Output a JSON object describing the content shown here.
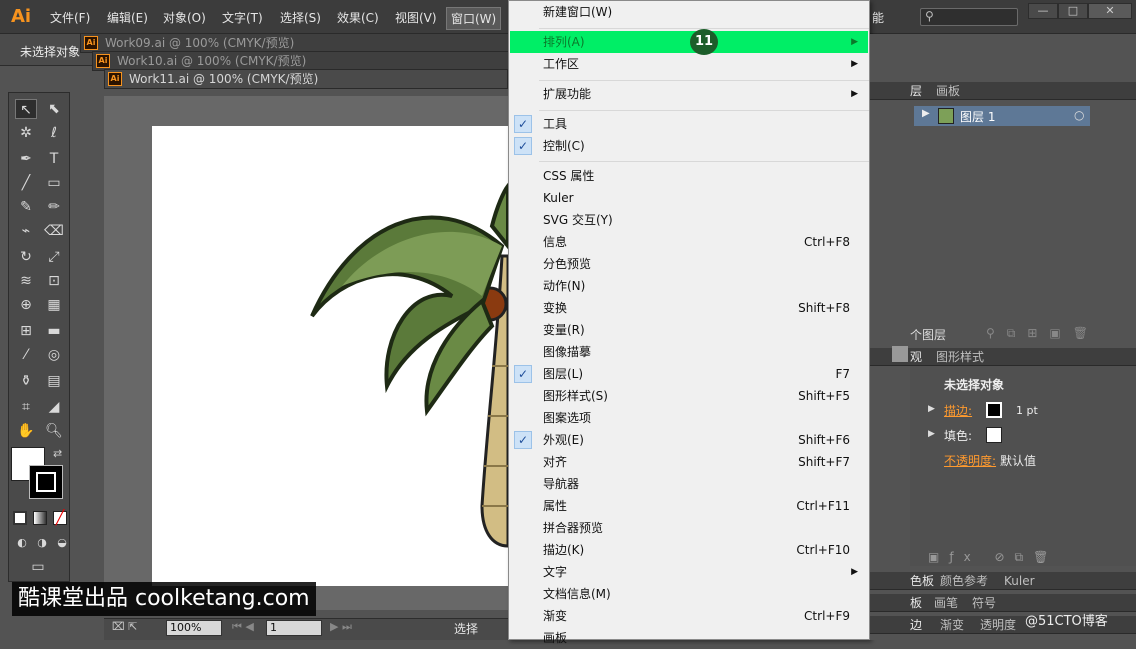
{
  "app": {
    "logo": "Ai"
  },
  "menubar": {
    "items": [
      "文件(F)",
      "编辑(E)",
      "对象(O)",
      "文字(T)",
      "选择(S)",
      "效果(C)",
      "视图(V)",
      "窗口(W)"
    ],
    "active": "窗口(W)",
    "right_text": "能"
  },
  "control": {
    "no_selection": "未选择对象"
  },
  "documents": [
    {
      "title": "Work09.ai @ 100% (CMYK/预览)"
    },
    {
      "title": "Work10.ai @ 100% (CMYK/预览)"
    },
    {
      "title": "Work11.ai @ 100% (CMYK/预览)"
    }
  ],
  "ai_badge": "Ai",
  "statusbar": {
    "zoom": "100%",
    "artboard": "1",
    "tool": "选择"
  },
  "window_menu": [
    {
      "label": "新建窗口(W)",
      "shortcut": "",
      "submenu": false,
      "checked": false
    },
    {
      "label": "排列(A)",
      "shortcut": "",
      "submenu": true,
      "checked": false,
      "highlight": true
    },
    {
      "label": "工作区",
      "shortcut": "",
      "submenu": true,
      "checked": false
    },
    {
      "label": "扩展功能",
      "shortcut": "",
      "submenu": true,
      "checked": false
    },
    {
      "label": "工具",
      "shortcut": "",
      "submenu": false,
      "checked": true
    },
    {
      "label": "控制(C)",
      "shortcut": "",
      "submenu": false,
      "checked": true
    },
    {
      "label": "CSS 属性",
      "shortcut": "",
      "submenu": false,
      "checked": false
    },
    {
      "label": "Kuler",
      "shortcut": "",
      "submenu": false,
      "checked": false
    },
    {
      "label": "SVG 交互(Y)",
      "shortcut": "",
      "submenu": false,
      "checked": false
    },
    {
      "label": "信息",
      "shortcut": "Ctrl+F8",
      "submenu": false,
      "checked": false
    },
    {
      "label": "分色预览",
      "shortcut": "",
      "submenu": false,
      "checked": false
    },
    {
      "label": "动作(N)",
      "shortcut": "",
      "submenu": false,
      "checked": false
    },
    {
      "label": "变换",
      "shortcut": "Shift+F8",
      "submenu": false,
      "checked": false
    },
    {
      "label": "变量(R)",
      "shortcut": "",
      "submenu": false,
      "checked": false
    },
    {
      "label": "图像描摹",
      "shortcut": "",
      "submenu": false,
      "checked": false
    },
    {
      "label": "图层(L)",
      "shortcut": "F7",
      "submenu": false,
      "checked": true
    },
    {
      "label": "图形样式(S)",
      "shortcut": "Shift+F5",
      "submenu": false,
      "checked": false
    },
    {
      "label": "图案选项",
      "shortcut": "",
      "submenu": false,
      "checked": false
    },
    {
      "label": "外观(E)",
      "shortcut": "Shift+F6",
      "submenu": false,
      "checked": true
    },
    {
      "label": "对齐",
      "shortcut": "Shift+F7",
      "submenu": false,
      "checked": false
    },
    {
      "label": "导航器",
      "shortcut": "",
      "submenu": false,
      "checked": false
    },
    {
      "label": "属性",
      "shortcut": "Ctrl+F11",
      "submenu": false,
      "checked": false
    },
    {
      "label": "拼合器预览",
      "shortcut": "",
      "submenu": false,
      "checked": false
    },
    {
      "label": "描边(K)",
      "shortcut": "Ctrl+F10",
      "submenu": false,
      "checked": false
    },
    {
      "label": "文字",
      "shortcut": "",
      "submenu": true,
      "checked": false
    },
    {
      "label": "文档信息(M)",
      "shortcut": "",
      "submenu": false,
      "checked": false
    },
    {
      "label": "渐变",
      "shortcut": "Ctrl+F9",
      "submenu": false,
      "checked": false
    },
    {
      "label": "画板",
      "shortcut": "",
      "submenu": false,
      "checked": false
    }
  ],
  "step_badge": "11",
  "panels": {
    "layers_tabs": [
      "层",
      "画板"
    ],
    "layer_name": "图层 1",
    "layer_count": "个图层",
    "appearance_tabs": [
      "观",
      "图形样式"
    ],
    "appearance_title": "未选择对象",
    "stroke_label": "描边:",
    "stroke_value": "1 pt",
    "fill_label": "填色:",
    "opacity_label": "不透明度:",
    "opacity_value": "默认值",
    "swatch_tabs": [
      "色板",
      "颜色参考",
      "Kuler"
    ],
    "brush_tabs": [
      "板",
      "画笔",
      "符号"
    ],
    "gradient_tabs": [
      "边",
      "渐变",
      "透明度"
    ]
  },
  "watermark": "酷课堂出品 coolketang.com",
  "copyright": "@51CTO博客",
  "colors": {
    "highlight": "#00ee66",
    "badge": "#1c5e2a",
    "accent": "#ff9a2e"
  }
}
